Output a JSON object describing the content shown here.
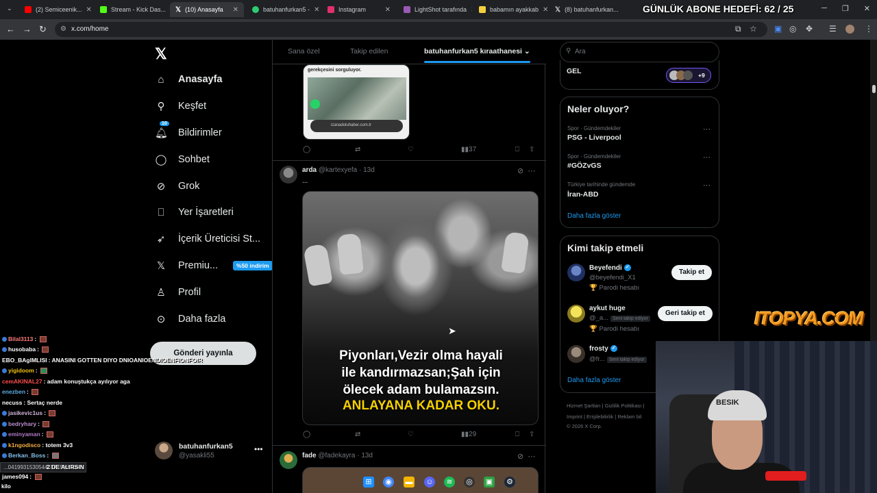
{
  "browser": {
    "tabs": [
      {
        "label": "(2) Semiceenik...",
        "color": "#ff0000"
      },
      {
        "label": "Stream - Kick Das...",
        "color": "#53fc18"
      },
      {
        "label": "(10) Anasayfa",
        "color": "#ffffff"
      },
      {
        "label": "batuhanfurkan5 -",
        "color": "#2ecc71"
      },
      {
        "label": "Instagram",
        "color": "#e1306c"
      },
      {
        "label": "LightShot tarafında",
        "color": "#9b59b6"
      },
      {
        "label": "babamın ayakkab",
        "color": "#f4d03f"
      },
      {
        "label": "(8) batuhanfurkan...",
        "color": "#ffffff"
      }
    ],
    "url": "x.com/home",
    "stream_overlay_title": "GÜNLÜK ABONE HEDEFİ: 62 / 25"
  },
  "sidebar": {
    "logo": "𝕏",
    "items": [
      {
        "label": "Anasayfa",
        "icon": "home-icon",
        "glyph": "⌂"
      },
      {
        "label": "Keşfet",
        "icon": "search-icon",
        "glyph": "⚲"
      },
      {
        "label": "Bildirimler",
        "icon": "bell-icon",
        "glyph": "♫",
        "badge": "10"
      },
      {
        "label": "Sohbet",
        "icon": "chat-icon",
        "glyph": "◯"
      },
      {
        "label": "Grok",
        "icon": "grok-icon",
        "glyph": "⊘"
      },
      {
        "label": "Yer İşaretleri",
        "icon": "bookmark-icon",
        "glyph": "⎕"
      },
      {
        "label": "İçerik Üreticisi St...",
        "icon": "rocket-icon",
        "glyph": "➶"
      },
      {
        "label": "Premiu...",
        "icon": "x-premium-icon",
        "glyph": "𝕏",
        "promo": "%50 indirim"
      },
      {
        "label": "Profil",
        "icon": "profile-icon",
        "glyph": "♙"
      },
      {
        "label": "Daha fazla",
        "icon": "more-circle-icon",
        "glyph": "⊙"
      }
    ],
    "post_button": "Gönderi yayınla",
    "account": {
      "name": "batuhanfurkan5",
      "handle": "@yasakli55"
    }
  },
  "timeline": {
    "tabs": [
      "Sana özel",
      "Takip edilen",
      "batuhanfurkan5 kıraathanesi"
    ],
    "post1": {
      "image_text": "gerekçesini sorguluyor.",
      "link": "izanadoluhaber.com.tr",
      "views": "37"
    },
    "post2": {
      "name": "arda",
      "handle": "@kartexyefa",
      "time": "13d",
      "text": "...",
      "caption_line1": "Piyonları,Vezir olma hayali",
      "caption_line2": "ile kandırmazsan;Şah için",
      "caption_line3": "ölecek adam bulamazsın.",
      "caption_line4": "ANLAYANA KADAR OKU.",
      "views": "29"
    },
    "post3": {
      "name": "fade",
      "handle": "@fadekayra",
      "time": "13d"
    }
  },
  "right": {
    "search_placeholder": "Ara",
    "community": {
      "label": "GEL",
      "count": "+9"
    },
    "trends_title": "Neler oluyor?",
    "trends": [
      {
        "category": "Spor · Gündemdekiler",
        "name": "PSG - Liverpool"
      },
      {
        "category": "Spor · Gündemdekiler",
        "name": "#GÖZvGS"
      },
      {
        "category": "Türkiye tarihinde gündemde",
        "name": "İran-ABD"
      }
    ],
    "show_more": "Daha fazla göster",
    "who_title": "Kimi takip etmeli",
    "who": [
      {
        "name": "Beyefendi",
        "handle": "@beyefendi_X1",
        "sub": "🏆 Parodi hesabı",
        "button": "Takip et",
        "verified": true
      },
      {
        "name": "aykut huge",
        "handle": "@_a...",
        "follows_you": "Seni takip ediyor",
        "sub": "🏆 Parodi hesabı",
        "button": "Geri takip et"
      },
      {
        "name": "frosty",
        "handle": "@fr...",
        "follows_you": "Seni takip ediyor",
        "verified": true
      }
    ],
    "who_show_more": "Daha fazla göster",
    "footer_line1": "Hizmet Şartları   |   Gizlilik Politikası   |",
    "footer_line2": "Imprint   |   Erişilebilirlik   |   Reklam bil",
    "footer_line3": "© 2026 X Corp."
  },
  "chat": [
    {
      "user": "Bilal3113",
      "msg": "",
      "color": "#ff7b7b"
    },
    {
      "user": "husobaba",
      "msg": "",
      "color": "#ffffff"
    },
    {
      "user": "EBO_BAgIMLISI",
      "msg": "ANASINI GOTTEN DIYO DNIOANIOENDIOENFIONFOIR",
      "color": "#ffffff"
    },
    {
      "user": "yigidoom",
      "msg": "",
      "color": "#f1c40f"
    },
    {
      "user": "cemAKINAL27",
      "msg": "adam konuştukça ayılıyor aga",
      "color": "#ff4d4d"
    },
    {
      "user": "enezben",
      "msg": "",
      "color": "#5dade2"
    },
    {
      "user": "necuss",
      "msg": "Sertaç nerde",
      "color": "#ffffff"
    },
    {
      "user": "jasikevic1us",
      "msg": "",
      "color": "#d2b4de"
    },
    {
      "user": "bedryhary",
      "msg": "",
      "color": "#bb8fce"
    },
    {
      "user": "eminyaman",
      "msg": "",
      "color": "#af7ac5"
    },
    {
      "user": "k1ngodisco",
      "msg": "totem 3v3",
      "color": "#f5b041"
    },
    {
      "user": "Berkan_Boss",
      "msg": "",
      "color": "#85c1e9"
    },
    {
      "user": "james094",
      "msg": "",
      "color": "#ffffff"
    }
  ],
  "chat_partial": "2 DE ALIRSIN",
  "status_url": "...041993153054445645/photo/1",
  "kilo": "kilo",
  "sponsor": "ITOPYA.COM",
  "webcam_hat": "BESIK"
}
